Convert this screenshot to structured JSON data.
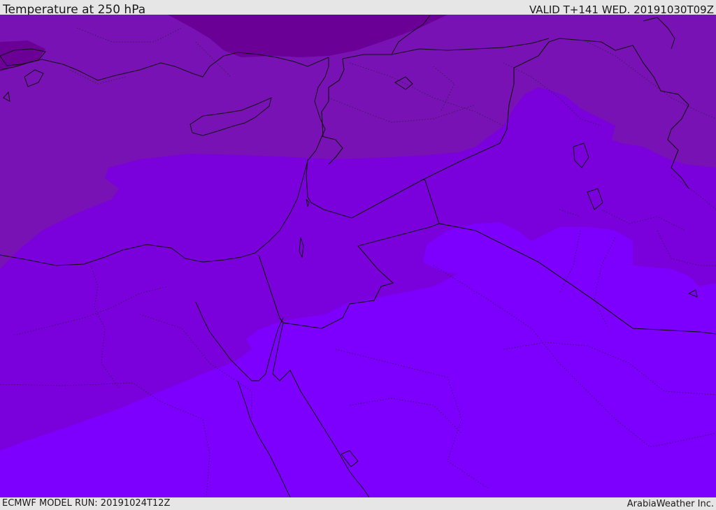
{
  "header": {
    "title": "Temperature at 250 hPa",
    "valid": "VALID T+141 WED. 20191030T09Z"
  },
  "footer": {
    "model_run": "ECMWF MODEL RUN: 20191024T12Z",
    "credit": "ArabiaWeather Inc."
  },
  "colors": {
    "temp_coldest": "#6a0096",
    "temp_cold": "#7812b4",
    "temp_mid": "#7a00dc",
    "temp_warm": "#7d00ff",
    "coastline": "#111111",
    "border": "#111111"
  }
}
